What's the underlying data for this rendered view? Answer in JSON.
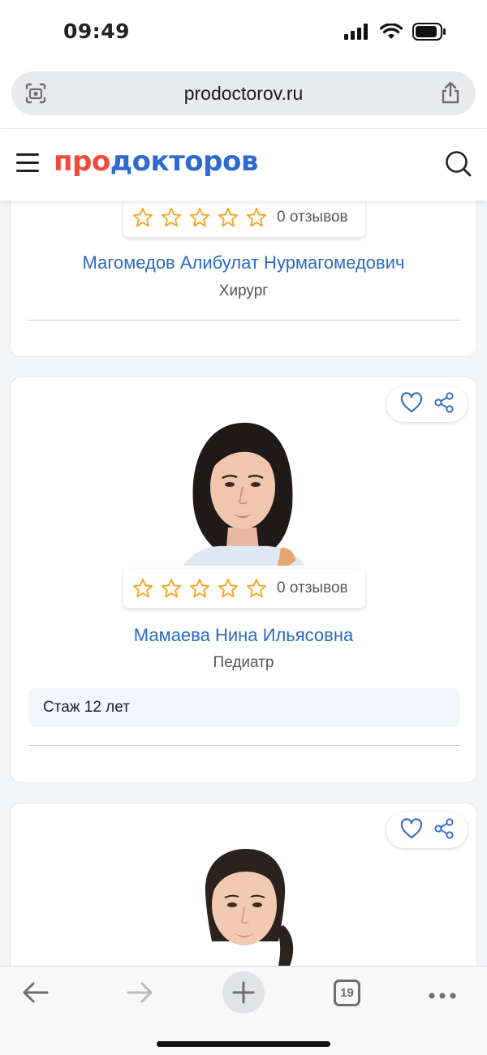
{
  "status_bar": {
    "time": "09:49"
  },
  "browser": {
    "url": "prodoctorov.ru",
    "tab_count": "19"
  },
  "site": {
    "logo_part1": "про",
    "logo_part2": "докторов"
  },
  "colors": {
    "brand_red": "#ef4b3a",
    "brand_blue": "#2f6ad0",
    "link_blue": "#2a6ac3",
    "star": "#f2a31c"
  },
  "doctors": [
    {
      "name": "Магомедов Алибулат Нурмагомедович",
      "specialty": "Хирург",
      "rating_stars": 0,
      "reviews": "0 отзывов"
    },
    {
      "name": "Мамаева Нина Ильясовна",
      "specialty": "Педиатр",
      "rating_stars": 0,
      "reviews": "0 отзывов",
      "experience": "Стаж 12 лет"
    },
    {
      "name": "",
      "specialty": "",
      "rating_stars": 0
    }
  ],
  "icons": {
    "favorite": "heart-icon",
    "share": "share-icon",
    "menu": "hamburger-menu-icon",
    "search": "search-icon",
    "back": "arrow-left-icon",
    "forward": "arrow-right-icon",
    "new_tab": "plus-icon",
    "more": "more-dots-icon"
  }
}
